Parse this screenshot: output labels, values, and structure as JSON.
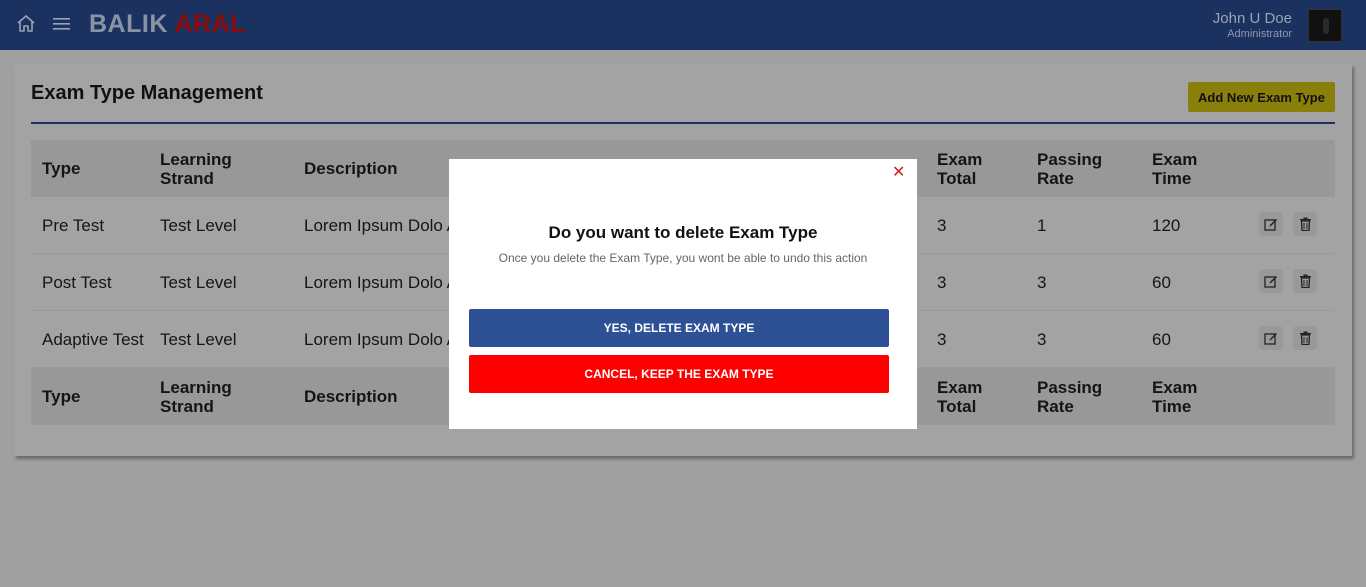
{
  "topbar": {
    "brand_part1": "BALIK",
    "brand_part2": "ARAL",
    "user_name": "John U Doe",
    "user_role": "Administrator",
    "home_icon": "home-icon",
    "menu_icon": "hamburger-menu-icon"
  },
  "page": {
    "title": "Exam Type Management",
    "add_button_label": "Add New Exam Type"
  },
  "table": {
    "headers": [
      "Type",
      "Learning Strand",
      "Description",
      "Exam Total",
      "Passing Rate",
      "Exam Time"
    ],
    "rows": [
      {
        "type": "Pre Test",
        "strand": "Test Level",
        "description": "Lorem Ipsum Dolo Adepescin Elit",
        "total": "3",
        "passing": "1",
        "time": "120"
      },
      {
        "type": "Post Test",
        "strand": "Test Level",
        "description": "Lorem Ipsum Dolo Adepescin Elit",
        "total": "3",
        "passing": "3",
        "time": "60"
      },
      {
        "type": "Adaptive Test",
        "strand": "Test Level",
        "description": "Lorem Ipsum Dolo Adepescin Elit",
        "total": "3",
        "passing": "3",
        "time": "60"
      }
    ]
  },
  "modal": {
    "title": "Do you want to delete Exam Type",
    "subtitle": "Once you delete the Exam Type, you wont be able to undo this action",
    "confirm_label": "YES, DELETE EXAM TYPE",
    "cancel_label": "CANCEL, KEEP THE EXAM TYPE",
    "close_glyph": "✕"
  },
  "colors": {
    "topbar": "#1b3260",
    "brand_accent": "#e0141b",
    "confirm": "#2d5194",
    "cancel": "#ff0000",
    "add_button": "#c8b810"
  }
}
